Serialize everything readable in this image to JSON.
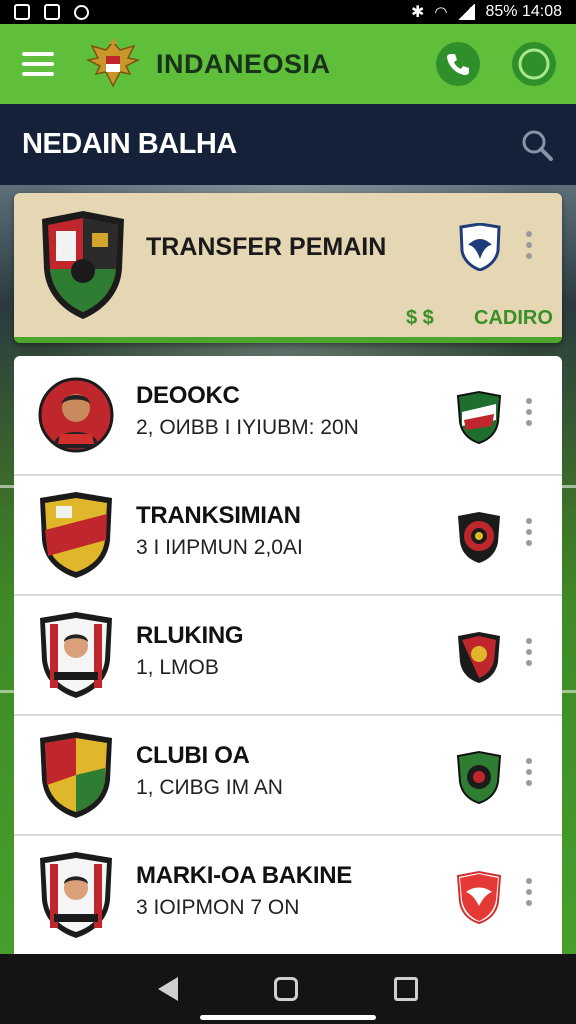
{
  "status_bar": {
    "battery_time": "85% 14:08",
    "icons": [
      "image-icon",
      "notification-icon",
      "alarm-icon",
      "wifi-icon",
      "signal-icon"
    ]
  },
  "app_bar": {
    "title": "INDANEOSIA",
    "menu_icon": "hamburger-icon",
    "logo_icon": "garuda-emblem-icon",
    "actions": [
      "phone-icon",
      "circle-status-icon"
    ]
  },
  "header": {
    "title": "NEDAIN BALHA",
    "search_icon": "search-icon"
  },
  "featured": {
    "title": "TRANSFER PEMAIN",
    "price": "$ $",
    "status": "CADIRO"
  },
  "players": [
    {
      "name": "DEOOKC",
      "detail": "2, ОИBB I IYIUBM: 20N"
    },
    {
      "name": "TRANKSIMIAN",
      "detail": "3 I IИPMUN 2,0AI"
    },
    {
      "name": "RLUKING",
      "detail": "1, LMOB"
    },
    {
      "name": "CLUBI OA",
      "detail": "1, СИBG IM AN"
    },
    {
      "name": "MARKI-OA BAKINE",
      "detail": "3 IOIPMON 7 ON"
    }
  ],
  "colors": {
    "app_bar": "#5fbf3b",
    "header_bar": "#142138",
    "featured_card": "#e5d6b4",
    "accent_green": "#3b8f28",
    "nav_bar": "#141414"
  }
}
